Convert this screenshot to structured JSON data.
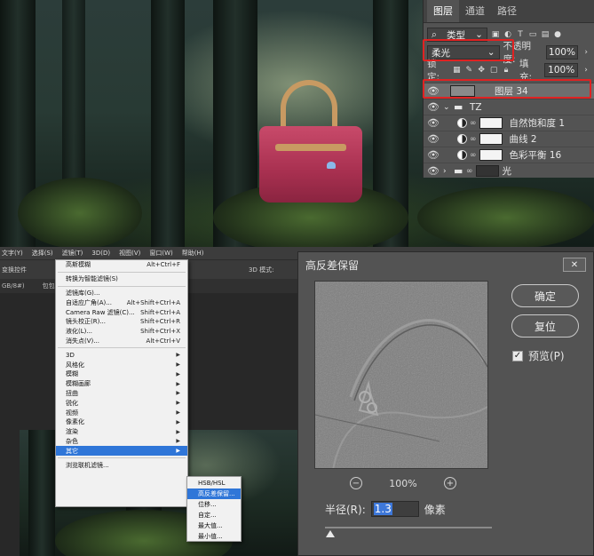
{
  "layers_panel": {
    "tabs": [
      "图层",
      "通道",
      "路径"
    ],
    "filter_kind": "类型",
    "blend_mode": "柔光",
    "opacity_label": "不透明度:",
    "opacity_value": "100%",
    "lock_label": "锁定:",
    "fill_label": "填充:",
    "fill_value": "100%",
    "layers": [
      {
        "name": "图层 34"
      },
      {
        "name": "TZ"
      },
      {
        "name": "自然饱和度 1"
      },
      {
        "name": "曲线 2"
      },
      {
        "name": "色彩平衡 16"
      },
      {
        "name": "光"
      }
    ]
  },
  "menubar": {
    "items": [
      "文字(Y)",
      "选择(S)",
      "滤镜(T)",
      "3D(D)",
      "视图(V)",
      "窗口(W)",
      "帮助(H)"
    ]
  },
  "options_bar": {
    "left_text": "变换控件",
    "right_text": "3D 模式:"
  },
  "doc_tabs": {
    "tab1": "GB/8#)",
    "tab2": "包包"
  },
  "filter_menu": {
    "items": [
      {
        "label": "高斯模糊",
        "shortcut": "Alt+Ctrl+F"
      },
      {
        "label": "转换为智能滤镜(S)",
        "shortcut": ""
      },
      {
        "label": "滤镜库(G)...",
        "shortcut": ""
      },
      {
        "label": "自适应广角(A)...",
        "shortcut": "Alt+Shift+Ctrl+A"
      },
      {
        "label": "Camera Raw 滤镜(C)...",
        "shortcut": "Shift+Ctrl+A"
      },
      {
        "label": "镜头校正(R)...",
        "shortcut": "Shift+Ctrl+R"
      },
      {
        "label": "液化(L)...",
        "shortcut": "Shift+Ctrl+X"
      },
      {
        "label": "消失点(V)...",
        "shortcut": "Alt+Ctrl+V"
      },
      {
        "label": "3D"
      },
      {
        "label": "风格化"
      },
      {
        "label": "模糊"
      },
      {
        "label": "模糊画廊"
      },
      {
        "label": "扭曲"
      },
      {
        "label": "锐化"
      },
      {
        "label": "视频"
      },
      {
        "label": "像素化"
      },
      {
        "label": "渲染"
      },
      {
        "label": "杂色"
      },
      {
        "label": "其它"
      },
      {
        "label": "浏览联机滤镜..."
      }
    ]
  },
  "submenu": {
    "items": [
      "HSB/HSL",
      "高反差保留...",
      "位移...",
      "自定...",
      "最大值...",
      "最小值..."
    ]
  },
  "dialog": {
    "title": "高反差保留",
    "close_symbol": "✕",
    "ok_label": "确定",
    "reset_label": "复位",
    "preview_label": "预览(P)",
    "zoom_level": "100%",
    "radius_label": "半径(R):",
    "radius_value": "1.3",
    "radius_unit": "像素"
  },
  "colors": {
    "highlight": "#2f76d8",
    "annotation_red": "#e02222",
    "panel_bg": "#535353"
  }
}
